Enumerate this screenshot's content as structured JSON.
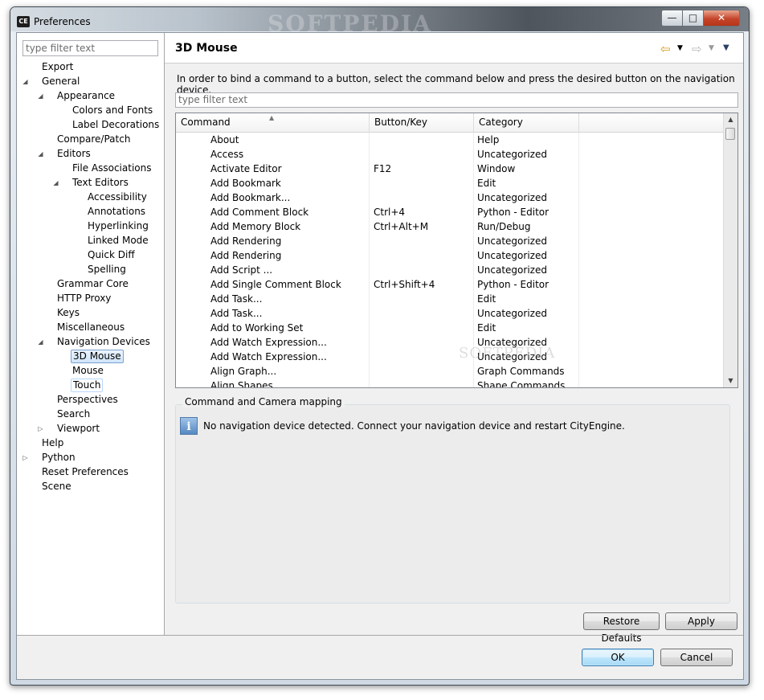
{
  "window": {
    "title": "Preferences",
    "icon_text": "CE",
    "watermark": "SOFTPEDIA",
    "controls": [
      "minimize-icon",
      "maximize-icon",
      "close-icon"
    ]
  },
  "tree": {
    "filter_placeholder": "type filter text",
    "nodes": [
      {
        "label": "Export",
        "level": 0,
        "arrow": ""
      },
      {
        "label": "General",
        "level": 0,
        "arrow": "expanded"
      },
      {
        "label": "Appearance",
        "level": 1,
        "arrow": "expanded"
      },
      {
        "label": "Colors and Fonts",
        "level": 2,
        "arrow": ""
      },
      {
        "label": "Label Decorations",
        "level": 2,
        "arrow": ""
      },
      {
        "label": "Compare/Patch",
        "level": 1,
        "arrow": ""
      },
      {
        "label": "Editors",
        "level": 1,
        "arrow": "expanded"
      },
      {
        "label": "File Associations",
        "level": 2,
        "arrow": ""
      },
      {
        "label": "Text Editors",
        "level": 2,
        "arrow": "expanded"
      },
      {
        "label": "Accessibility",
        "level": 3,
        "arrow": ""
      },
      {
        "label": "Annotations",
        "level": 3,
        "arrow": ""
      },
      {
        "label": "Hyperlinking",
        "level": 3,
        "arrow": ""
      },
      {
        "label": "Linked Mode",
        "level": 3,
        "arrow": ""
      },
      {
        "label": "Quick Diff",
        "level": 3,
        "arrow": ""
      },
      {
        "label": "Spelling",
        "level": 3,
        "arrow": ""
      },
      {
        "label": "Grammar Core",
        "level": 1,
        "arrow": ""
      },
      {
        "label": "HTTP Proxy",
        "level": 1,
        "arrow": ""
      },
      {
        "label": "Keys",
        "level": 1,
        "arrow": ""
      },
      {
        "label": "Miscellaneous",
        "level": 1,
        "arrow": ""
      },
      {
        "label": "Navigation Devices",
        "level": 1,
        "arrow": "expanded"
      },
      {
        "label": "3D Mouse",
        "level": 2,
        "arrow": "",
        "selected": true
      },
      {
        "label": "Mouse",
        "level": 2,
        "arrow": ""
      },
      {
        "label": "Touch",
        "level": 2,
        "arrow": "",
        "hover": true
      },
      {
        "label": "Perspectives",
        "level": 1,
        "arrow": ""
      },
      {
        "label": "Search",
        "level": 1,
        "arrow": ""
      },
      {
        "label": "Viewport",
        "level": 1,
        "arrow": "collapsed"
      },
      {
        "label": "Help",
        "level": 0,
        "arrow": ""
      },
      {
        "label": "Python",
        "level": 0,
        "arrow": "collapsed"
      },
      {
        "label": "Reset Preferences",
        "level": 0,
        "arrow": ""
      },
      {
        "label": "Scene",
        "level": 0,
        "arrow": ""
      }
    ]
  },
  "page": {
    "title": "3D Mouse",
    "nav_icons": [
      "back-arrow-icon",
      "dropdown-icon",
      "forward-arrow-icon",
      "dropdown-icon",
      "view-menu-icon"
    ],
    "description": "In order to bind a command to a button, select the command below and press the desired button on the navigation device.",
    "command_filter_placeholder": "type filter text",
    "table": {
      "columns": [
        "Command",
        "Button/Key",
        "Category"
      ],
      "rows": [
        [
          "About",
          "",
          "Help"
        ],
        [
          "Access",
          "",
          "Uncategorized"
        ],
        [
          "Activate Editor",
          "F12",
          "Window"
        ],
        [
          "Add Bookmark",
          "",
          "Edit"
        ],
        [
          "Add Bookmark...",
          "",
          "Uncategorized"
        ],
        [
          "Add Comment Block",
          "Ctrl+4",
          "Python - Editor"
        ],
        [
          "Add Memory Block",
          "Ctrl+Alt+M",
          "Run/Debug"
        ],
        [
          "Add Rendering",
          "",
          "Uncategorized"
        ],
        [
          "Add Rendering",
          "",
          "Uncategorized"
        ],
        [
          "Add Script ...",
          "",
          "Uncategorized"
        ],
        [
          "Add Single Comment Block",
          "Ctrl+Shift+4",
          "Python - Editor"
        ],
        [
          "Add Task...",
          "",
          "Edit"
        ],
        [
          "Add Task...",
          "",
          "Uncategorized"
        ],
        [
          "Add to Working Set",
          "",
          "Edit"
        ],
        [
          "Add Watch Expression...",
          "",
          "Uncategorized"
        ],
        [
          "Add Watch Expression...",
          "",
          "Uncategorized"
        ],
        [
          "Align Graph...",
          "",
          "Graph Commands"
        ],
        [
          "Align Shapes",
          "",
          "Shape Commands"
        ]
      ]
    },
    "watermark": "SOFTPEDIA",
    "group": {
      "title": "Command and Camera mapping",
      "info_text": "No navigation device detected. Connect your navigation device and restart CityEngine."
    },
    "buttons": {
      "restore_defaults": "Restore Defaults",
      "apply": "Apply"
    }
  },
  "dialog_buttons": {
    "ok": "OK",
    "cancel": "Cancel"
  }
}
